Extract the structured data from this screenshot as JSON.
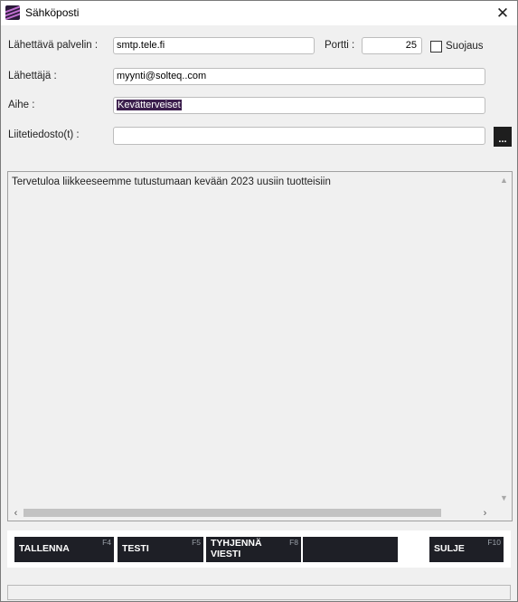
{
  "window": {
    "title": "Sähköposti",
    "icon": "app-logo-icon",
    "close_glyph": "✕"
  },
  "form": {
    "server_label": "Lähettävä palvelin :",
    "server_value": "smtp.tele.fi",
    "port_label": "Portti :",
    "port_value": "25",
    "security_label": "Suojaus",
    "security_checked": false,
    "sender_label": "Lähettäjä :",
    "sender_value": "myynti@solteq..com",
    "subject_label": "Aihe :",
    "subject_value": "Kevätterveiset",
    "attachment_label": "Liitetiedosto(t) :",
    "attachment_value": "",
    "browse_label": "..."
  },
  "message": {
    "body": "Tervetuloa liikkeeseemme tutustumaan kevään 2023 uusiin tuotteisiin",
    "scroll_up": "▲",
    "scroll_down": "▼",
    "scroll_left": "‹",
    "scroll_right": "›"
  },
  "buttons": [
    {
      "label": "TALLENNA",
      "key": "F4"
    },
    {
      "label": "TESTI",
      "key": "F5"
    },
    {
      "label": "TYHJENNÄ VIESTI",
      "key": "F8"
    },
    {
      "label": "",
      "key": ""
    },
    {
      "label": "SULJE",
      "key": "F10"
    }
  ],
  "colors": {
    "button_bg": "#1e1f26",
    "selection_bg": "#3c1f4d",
    "window_bg": "#f0f0f0"
  }
}
